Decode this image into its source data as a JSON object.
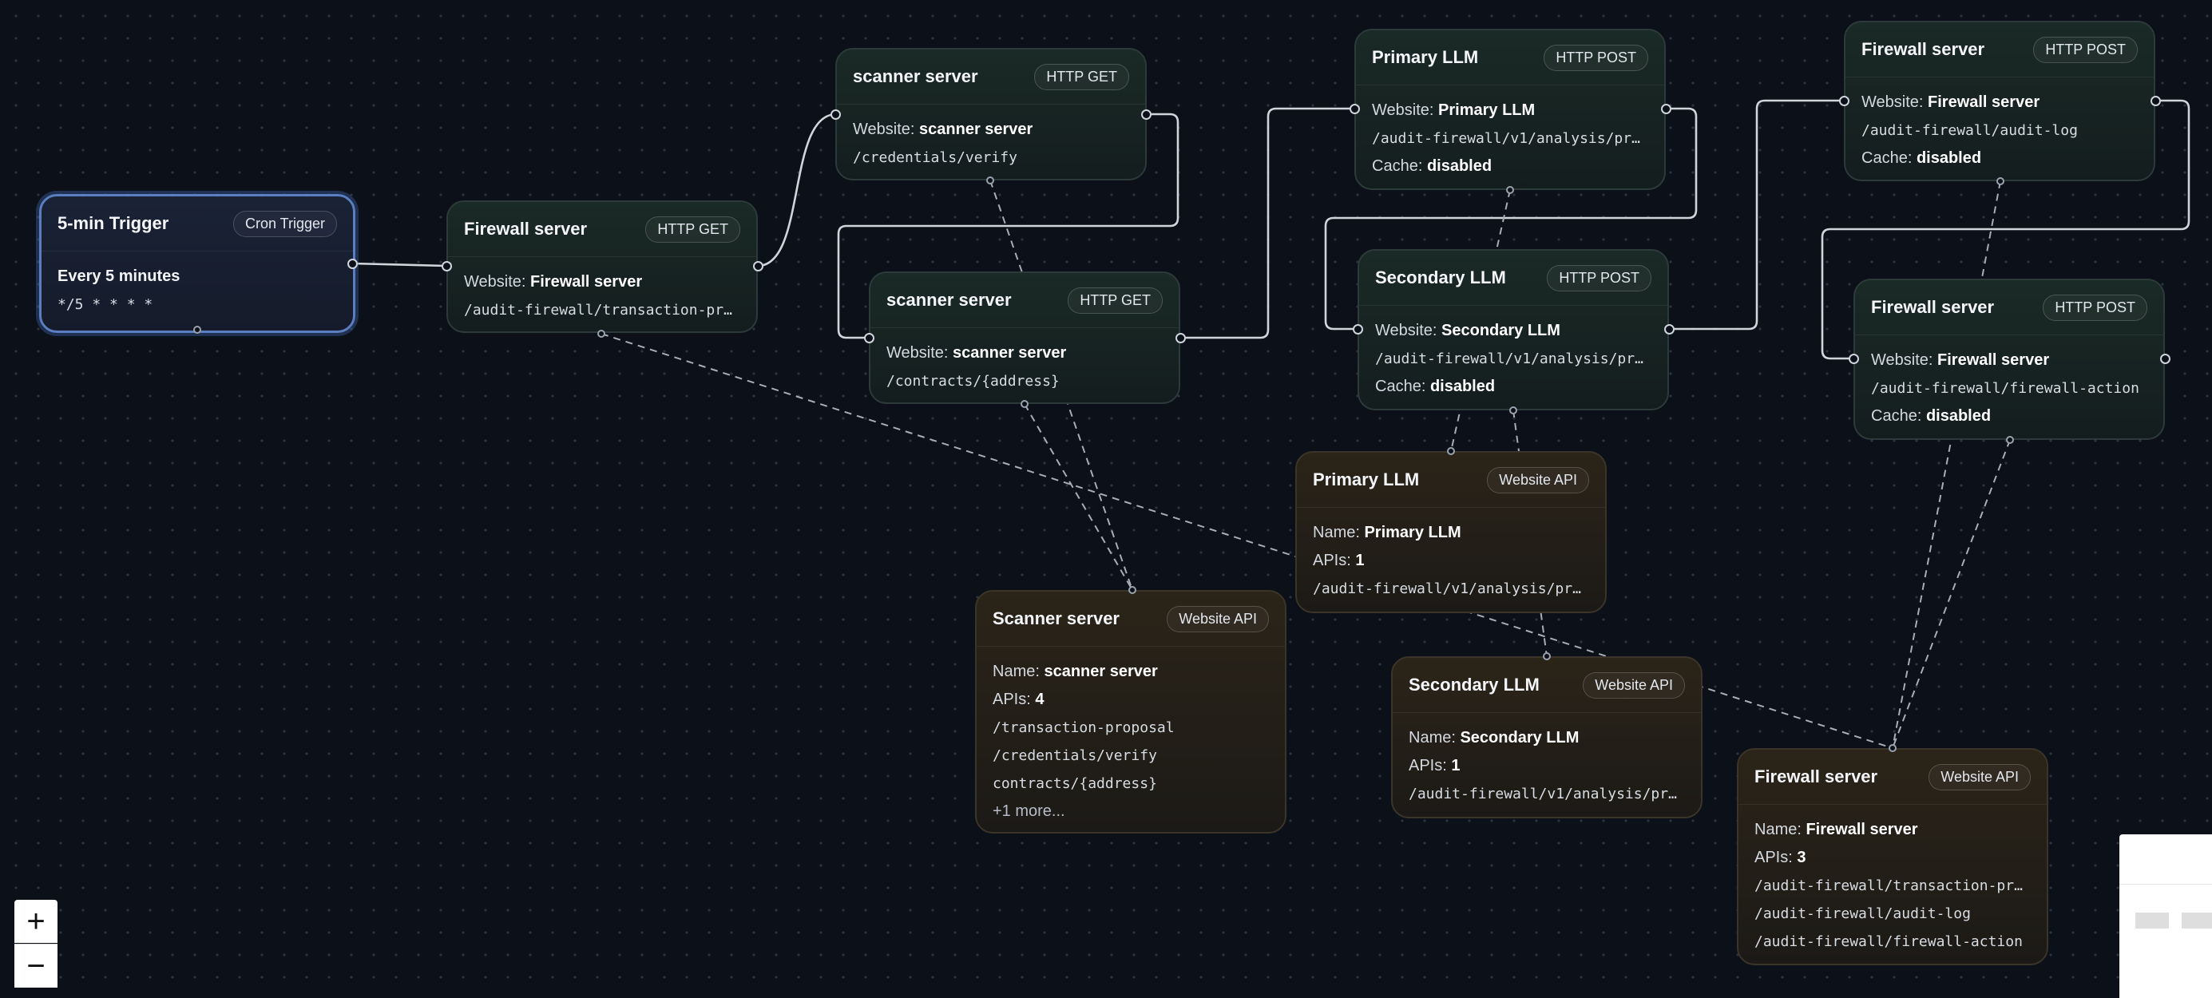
{
  "canvas": {
    "background": "#0c1018"
  },
  "nodes": {
    "trigger": {
      "title": "5-min Trigger",
      "badge": "Cron Trigger",
      "schedule": "Every 5 minutes",
      "cron": "*/5 * * * *"
    },
    "fw_get": {
      "title": "Firewall server",
      "badge": "HTTP GET",
      "website_label": "Website:",
      "website": "Firewall server",
      "path": "/audit-firewall/transaction-pro…"
    },
    "scan_cred": {
      "title": "scanner server",
      "badge": "HTTP GET",
      "website_label": "Website:",
      "website": "scanner server",
      "path": "/credentials/verify"
    },
    "scan_contracts": {
      "title": "scanner server",
      "badge": "HTTP GET",
      "website_label": "Website:",
      "website": "scanner server",
      "path": "/contracts/{address}"
    },
    "primary_post": {
      "title": "Primary LLM",
      "badge": "HTTP POST",
      "website_label": "Website:",
      "website": "Primary LLM",
      "path": "/audit-firewall/v1/analysis/pri…",
      "cache_label": "Cache:",
      "cache": "disabled"
    },
    "secondary_post": {
      "title": "Secondary LLM",
      "badge": "HTTP POST",
      "website_label": "Website:",
      "website": "Secondary LLM",
      "path": "/audit-firewall/v1/analysis/pri…",
      "cache_label": "Cache:",
      "cache": "disabled"
    },
    "fw_audit_post": {
      "title": "Firewall server",
      "badge": "HTTP POST",
      "website_label": "Website:",
      "website": "Firewall server",
      "path": "/audit-firewall/audit-log",
      "cache_label": "Cache:",
      "cache": "disabled"
    },
    "fw_action_post": {
      "title": "Firewall server",
      "badge": "HTTP POST",
      "website_label": "Website:",
      "website": "Firewall server",
      "path": "/audit-firewall/firewall-action",
      "cache_label": "Cache:",
      "cache": "disabled"
    },
    "primary_api": {
      "title": "Primary LLM",
      "badge": "Website API",
      "name_label": "Name:",
      "name": "Primary LLM",
      "apis_label": "APIs:",
      "apis": "1",
      "paths": [
        "/audit-firewall/v1/analysis/pri…"
      ]
    },
    "scanner_api": {
      "title": "Scanner server",
      "badge": "Website API",
      "name_label": "Name:",
      "name": "scanner server",
      "apis_label": "APIs:",
      "apis": "4",
      "paths": [
        "/transaction-proposal",
        "/credentials/verify",
        "contracts/{address}"
      ],
      "more": "+1 more..."
    },
    "secondary_api": {
      "title": "Secondary LLM",
      "badge": "Website API",
      "name_label": "Name:",
      "name": "Secondary LLM",
      "apis_label": "APIs:",
      "apis": "1",
      "paths": [
        "/audit-firewall/v1/analysis/pri…"
      ]
    },
    "firewall_api": {
      "title": "Firewall server",
      "badge": "Website API",
      "name_label": "Name:",
      "name": "Firewall server",
      "apis_label": "APIs:",
      "apis": "3",
      "paths": [
        "/audit-firewall/transaction-pro…",
        "/audit-firewall/audit-log",
        "/audit-firewall/firewall-action"
      ]
    }
  },
  "controls": {
    "zoom_in": "+",
    "zoom_out": "−"
  }
}
